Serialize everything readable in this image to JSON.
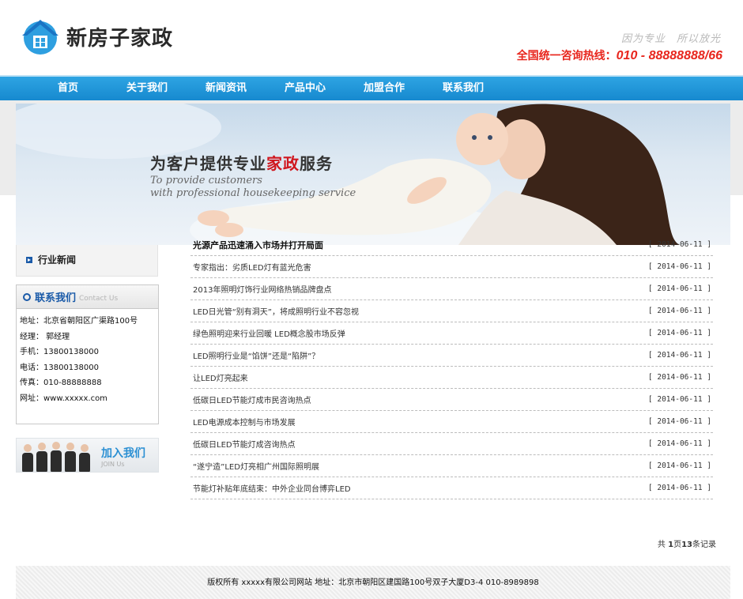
{
  "header": {
    "logo_text": "新房子家政",
    "slogan": "因为专业　所以放光",
    "hotline_label": "全国统一咨询热线：",
    "hotline_number": "010 - 88888888/66"
  },
  "nav": {
    "items": [
      {
        "label": "首页"
      },
      {
        "label": "关于我们"
      },
      {
        "label": "新闻资讯"
      },
      {
        "label": "产品中心"
      },
      {
        "label": "加盟合作"
      },
      {
        "label": "联系我们"
      }
    ]
  },
  "banner": {
    "title_pre": "为客户提供专业",
    "title_hl": "家政",
    "title_post": "服务",
    "sub_line1": "To provide customers",
    "sub_line2": "with professional housekeeping service"
  },
  "sidebar": {
    "news_category": "行业新闻",
    "contact": {
      "title": "联系我们",
      "title_en": "Contact Us",
      "rows": [
        "地址：北京省朝阳区广渠路100号",
        "经理： 郭经理",
        "手机：13800138000",
        "电话：13800138000",
        "传真：010-88888888",
        "网址：www.xxxxx.com"
      ]
    },
    "join": {
      "title": "加入我们",
      "title_en": "JOIN Us"
    }
  },
  "news": {
    "rows": [
      {
        "title": "光源产品迅速涌入市场并打开局面",
        "date": "[ 2014-06-11 ]",
        "bold": true
      },
      {
        "title": "专家指出：劣质LED灯有蓝光危害",
        "date": "[ 2014-06-11 ]"
      },
      {
        "title": "2013年照明灯饰行业网络热销品牌盘点",
        "date": "[ 2014-06-11 ]"
      },
      {
        "title": "LED日光管“别有洞天”，将成照明行业不容忽视",
        "date": "[ 2014-06-11 ]"
      },
      {
        "title": "绿色照明迎来行业回暖 LED概念股市场反弹",
        "date": "[ 2014-06-11 ]"
      },
      {
        "title": "LED照明行业是“馅饼”还是“陷阱”？",
        "date": "[ 2014-06-11 ]"
      },
      {
        "title": "让LED灯亮起来",
        "date": "[ 2014-06-11 ]"
      },
      {
        "title": "低碳日LED节能灯成市民咨询热点",
        "date": "[ 2014-06-11 ]"
      },
      {
        "title": "LED电源成本控制与市场发展",
        "date": "[ 2014-06-11 ]"
      },
      {
        "title": "低碳日LED节能灯成咨询热点",
        "date": "[ 2014-06-11 ]"
      },
      {
        "title": "“遂宁造”LED灯亮相广州国际照明展",
        "date": "[ 2014-06-11 ]"
      },
      {
        "title": "节能灯补贴年底结束：中外企业同台博弈LED",
        "date": "[ 2014-06-11 ]"
      }
    ],
    "pager_pre": "共 ",
    "pager_pages": "1",
    "pager_mid": "页",
    "pager_count": "13",
    "pager_post": "条记录"
  },
  "footer": {
    "text": "版权所有 xxxxx有限公司网站 地址：北京市朝阳区建国路100号双子大厦D3-4 010-8989898"
  },
  "colors": {
    "nav": "#1689cf",
    "accent_red": "#e8261d",
    "brand_blue": "#1a5aa8"
  }
}
